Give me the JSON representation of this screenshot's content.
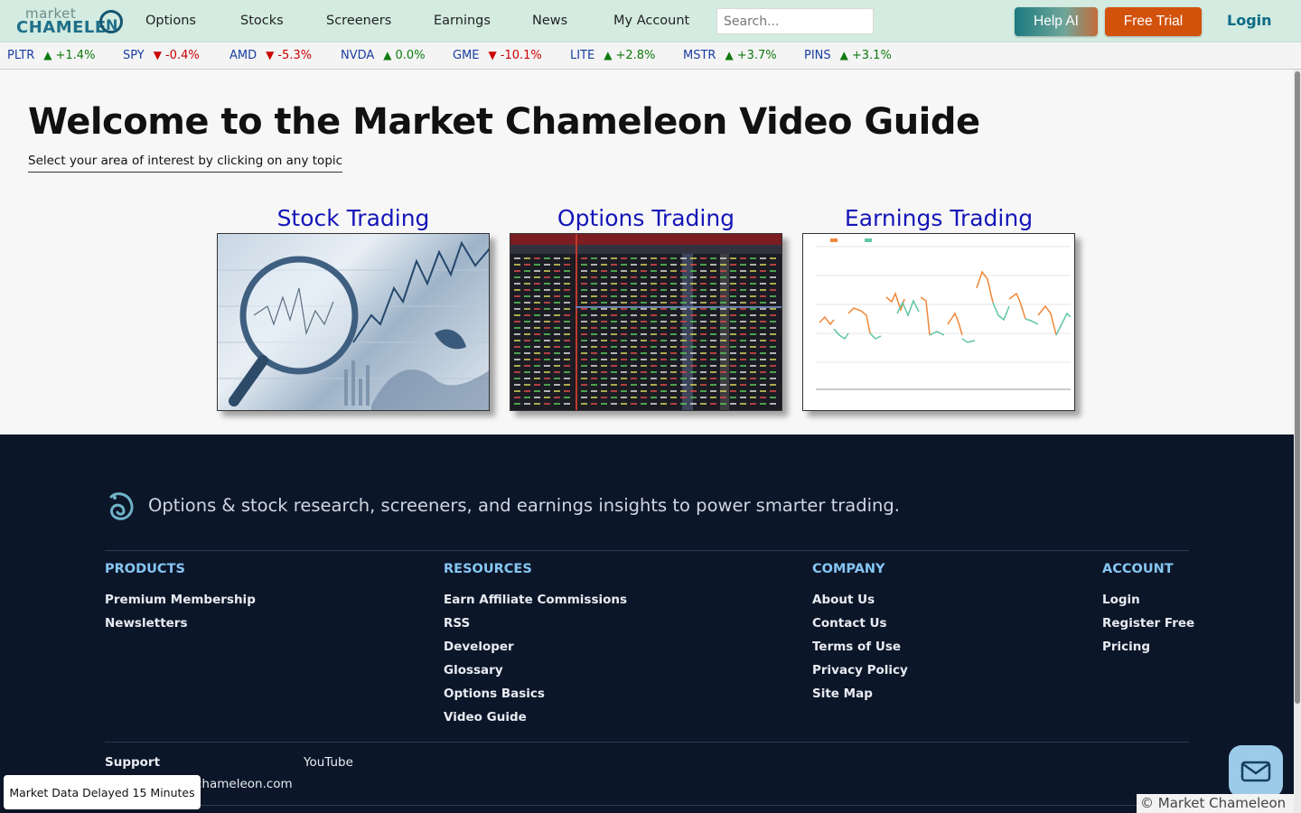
{
  "logo": {
    "top": "market",
    "bottom": "CHAMELE",
    "ring_letter": "N"
  },
  "nav": {
    "items": [
      "Options",
      "Stocks",
      "Screeners",
      "Earnings",
      "News",
      "My Account"
    ],
    "search_placeholder": "Search...",
    "help_label": "Help AI",
    "trial_label": "Free Trial",
    "login_label": "Login"
  },
  "ticker": [
    {
      "symbol": "PLTR",
      "change": "+1.4%",
      "direction": "up"
    },
    {
      "symbol": "SPY",
      "change": "-0.4%",
      "direction": "down"
    },
    {
      "symbol": "AMD",
      "change": "-5.3%",
      "direction": "down"
    },
    {
      "symbol": "NVDA",
      "change": "0.0%",
      "direction": "up"
    },
    {
      "symbol": "GME",
      "change": "-10.1%",
      "direction": "down"
    },
    {
      "symbol": "LITE",
      "change": "+2.8%",
      "direction": "up"
    },
    {
      "symbol": "MSTR",
      "change": "+3.7%",
      "direction": "up"
    },
    {
      "symbol": "PINS",
      "change": "+3.1%",
      "direction": "up"
    }
  ],
  "main": {
    "title": "Welcome to the Market Chameleon Video Guide",
    "subtitle": "Select your area of interest by clicking on any topic",
    "cards": [
      {
        "title": "Stock Trading"
      },
      {
        "title": "Options Trading"
      },
      {
        "title": "Earnings Trading"
      }
    ]
  },
  "footer": {
    "tagline": "Options & stock research, screeners, and earnings insights to power smarter trading.",
    "columns": [
      {
        "heading": "PRODUCTS",
        "links": [
          "Premium Membership",
          "Newsletters"
        ]
      },
      {
        "heading": "RESOURCES",
        "links": [
          "Earn Affiliate Commissions",
          "RSS",
          "Developer",
          "Glossary",
          "Options Basics",
          "Video Guide"
        ]
      },
      {
        "heading": "COMPANY",
        "links": [
          "About Us",
          "Contact Us",
          "Terms of Use",
          "Privacy Policy",
          "Site Map"
        ]
      },
      {
        "heading": "ACCOUNT",
        "links": [
          "Login",
          "Register Free",
          "Pricing"
        ]
      }
    ],
    "support_heading": "Support",
    "youtube_label": "YouTube",
    "support_email_partial": "chameleon.com",
    "delay_notice": "Market Data Delayed 15 Minutes",
    "copyright": "© Market Chameleon"
  },
  "colors": {
    "header_bg": "#d3ebe0",
    "trial_orange": "#d2520c",
    "footer_bg": "#0c1629",
    "footer_heading": "#86c6f2",
    "card_title": "#1515b8",
    "up": "#0d7a0d",
    "down": "#cc0000"
  },
  "icons": {
    "chat": "envelope-icon",
    "footer_logo": "chameleon-logo-icon",
    "up": "triangle-up-icon",
    "down": "triangle-down-icon"
  }
}
